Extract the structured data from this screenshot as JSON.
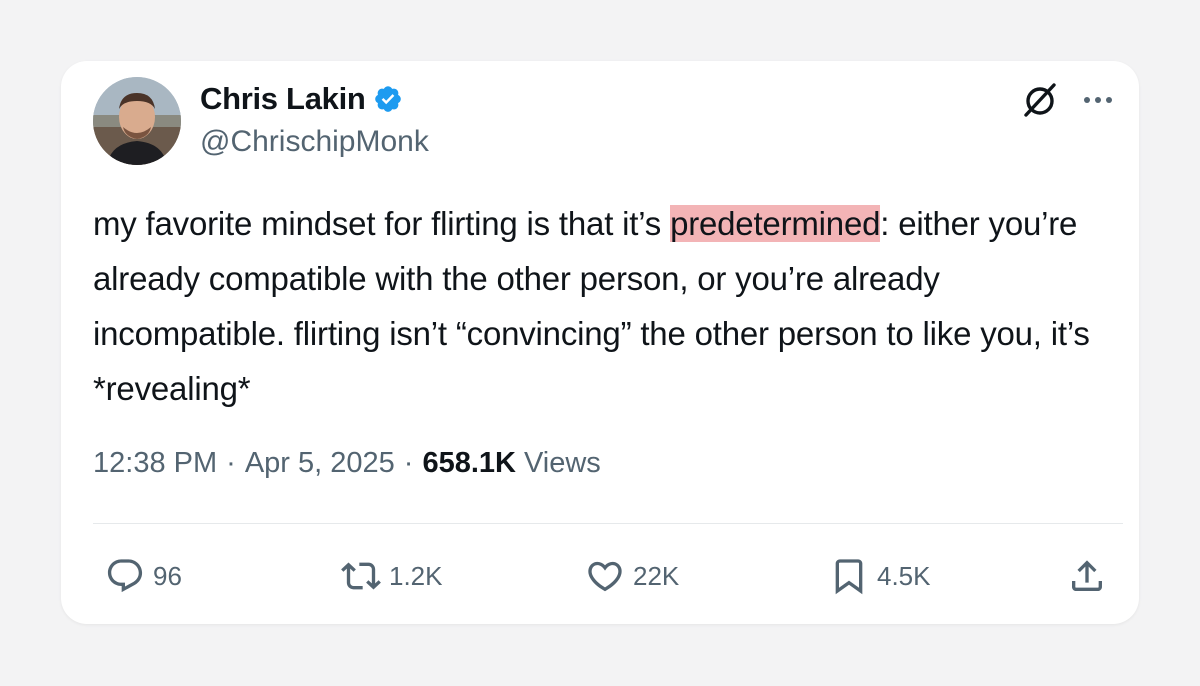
{
  "author": {
    "display_name": "Chris Lakin",
    "handle": "@ChrischipMonk",
    "verified": true,
    "verified_badge_color": "#1d9bf0",
    "avatar_icon": "profile-photo"
  },
  "header_icons": {
    "grok": "grok-icon",
    "more": "more-icon"
  },
  "tweet": {
    "text_before": "my favorite mindset for flirting is that it’s ",
    "highlighted": "predetermined",
    "text_after": ": either you’re already compatible with the other person, or you’re already incompatible. flirting isn’t “convincing” the other person to like you, it’s *revealing*",
    "highlight_color": "#f3b4b6"
  },
  "meta": {
    "time": "12:38 PM",
    "separator": "·",
    "date": "Apr 5, 2025",
    "views_count": "658.1K",
    "views_label": "Views"
  },
  "actions": {
    "replies": "96",
    "reposts": "1.2K",
    "likes": "22K",
    "bookmarks": "4.5K"
  },
  "colors": {
    "text": "#0f1419",
    "secondary": "#536471",
    "background": "#f3f3f4",
    "card": "#ffffff"
  }
}
